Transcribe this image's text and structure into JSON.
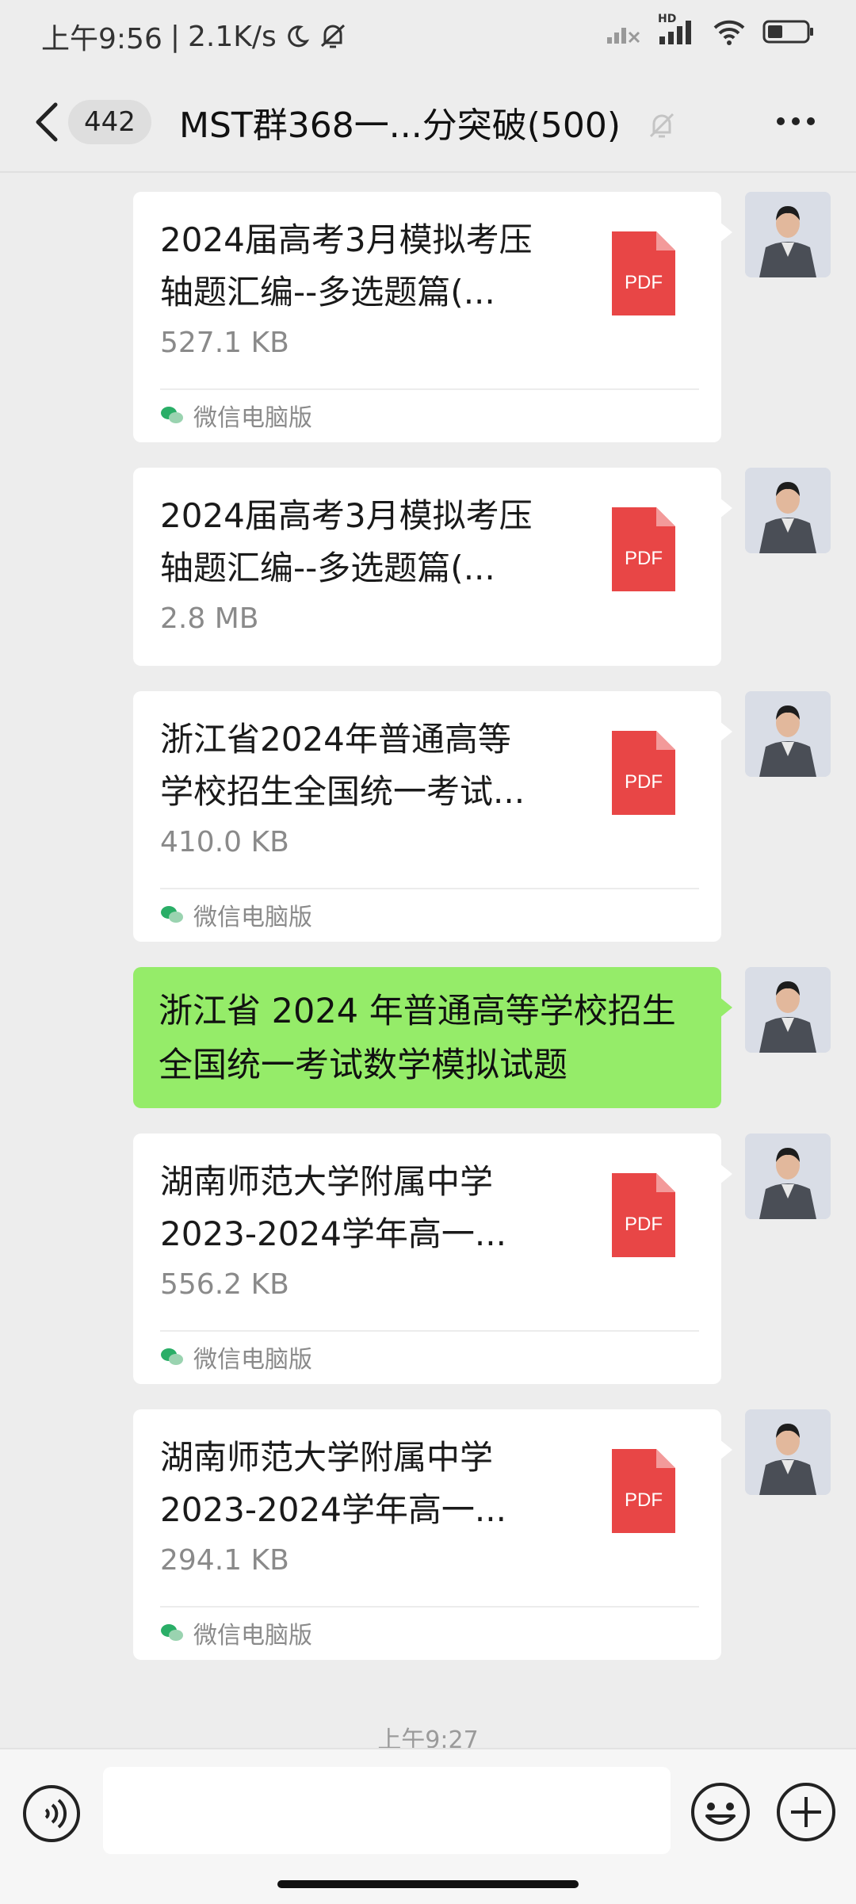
{
  "status_bar": {
    "time": "上午9:56",
    "speed": "2.1K/s",
    "network_label": "HD"
  },
  "header": {
    "back_badge": "442",
    "title": "MST群368一...分突破(500)"
  },
  "messages": [
    {
      "type": "file",
      "name": "2024届高考3月模拟考压轴题汇编--多选题篇(...",
      "size": "527.1 KB",
      "icon_label": "PDF",
      "source": "微信电脑版"
    },
    {
      "type": "file",
      "name": "2024届高考3月模拟考压轴题汇编--多选题篇(...",
      "size": "2.8 MB",
      "icon_label": "PDF",
      "source": ""
    },
    {
      "type": "file",
      "name": "浙江省2024年普通高等学校招生全国统一考试...",
      "size": "410.0 KB",
      "icon_label": "PDF",
      "source": "微信电脑版"
    },
    {
      "type": "text",
      "text": "浙江省 2024 年普通高等学校招生全国统一考试数学模拟试题"
    },
    {
      "type": "file",
      "name": "湖南师范大学附属中学2023-2024学年高一...",
      "size": "556.2 KB",
      "icon_label": "PDF",
      "source": "微信电脑版"
    },
    {
      "type": "file",
      "name": "湖南师范大学附属中学2023-2024学年高一...",
      "size": "294.1 KB",
      "icon_label": "PDF",
      "source": "微信电脑版"
    }
  ],
  "time_label": "上午9:27",
  "input": {
    "placeholder": ""
  },
  "colors": {
    "background": "#ededed",
    "bubble_self": "#95ec69",
    "pdf_red": "#e84646",
    "wechat_green": "#2aae67"
  }
}
